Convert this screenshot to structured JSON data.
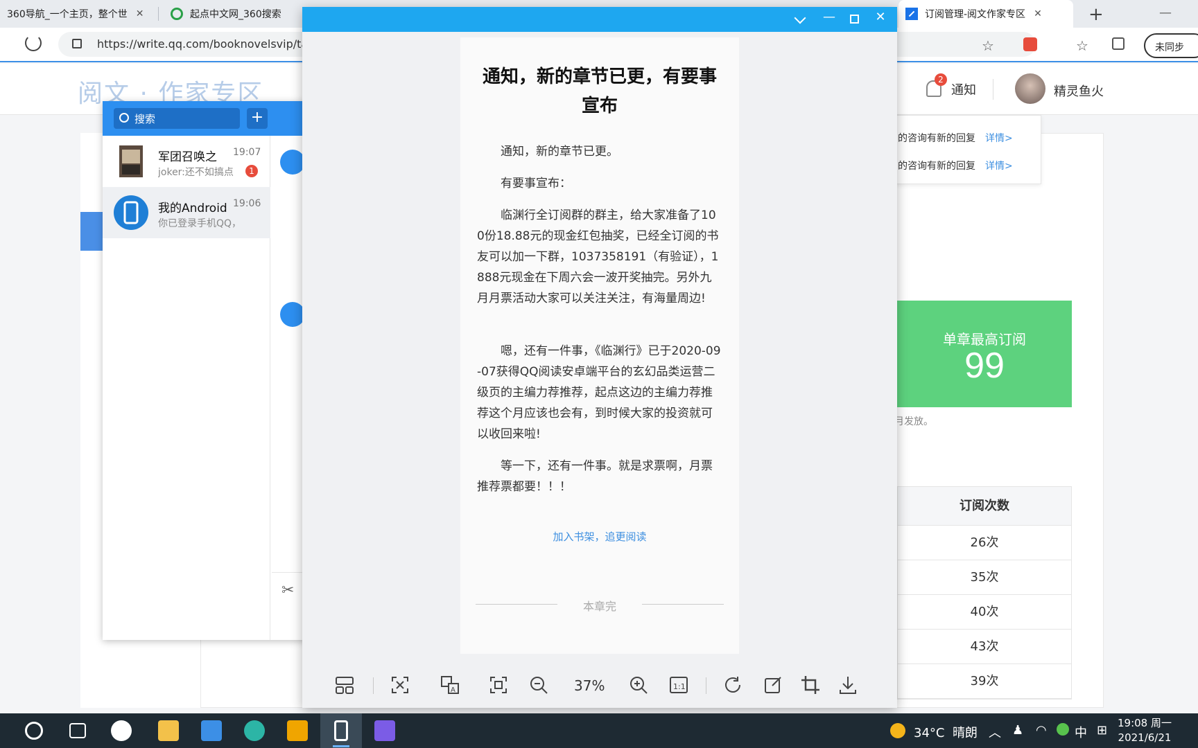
{
  "browser": {
    "tabs": [
      {
        "title": "360导航_一个主页，整个世"
      },
      {
        "title": "起点中文网_360搜索"
      },
      {
        "title": "订阅管理-阅文作家专区"
      }
    ],
    "url": "https://write.qq.com/booknovelsvip/ta",
    "sync_label": "未同步"
  },
  "site": {
    "logo": "阅文 · 作家专区",
    "notice_count": "2",
    "notice_label": "通知",
    "username": "精灵鱼火",
    "notifications": [
      {
        "text": "的咨询有新的回复",
        "link": "详情>"
      },
      {
        "text": "的咨询有新的回复",
        "link": "详情>"
      }
    ],
    "stat": {
      "label": "单章最高订阅",
      "value": "99"
    },
    "note": "月发放。",
    "table": {
      "header": "订阅次数",
      "rows": [
        "26次",
        "35次",
        "40次",
        "43次",
        "39次"
      ]
    }
  },
  "qq": {
    "search_placeholder": "搜索",
    "plus": "+",
    "chats": [
      {
        "name": "军团召唤之",
        "time": "19:07",
        "preview": "joker:还不如搞点",
        "unread": "1"
      },
      {
        "name": "我的Android",
        "time": "19:06",
        "preview": "你已登录手机QQ，可"
      }
    ]
  },
  "viewer": {
    "zoom": "37%",
    "article": {
      "title": "通知，新的章节已更，有要事宣布",
      "paragraphs": [
        "通知，新的章节已更。",
        "有要事宣布：",
        "临渊行全订阅群的群主，给大家准备了100份18.88元的现金红包抽奖，已经全订阅的书友可以加一下群，1037358191（有验证），1888元现金在下周六会一波开奖抽完。另外九月月票活动大家可以关注关注，有海量周边!",
        "嗯，还有一件事，《临渊行》已于2020-09-07获得QQ阅读安卓端平台的玄幻品类运营二级页的主编力荐推荐，起点这边的主编力荐推荐这个月应该也会有，到时候大家的投资就可以收回来啦!",
        "等一下，还有一件事。就是求票啊，月票推荐票都要！！！"
      ],
      "bookshelf_link": "加入书架，追更阅读",
      "end_label": "本章完"
    }
  },
  "taskbar": {
    "weather_temp": "34°C",
    "weather_desc": "晴朗",
    "ime": "中",
    "clock_time": "19:08 周一",
    "clock_date": "2021/6/21"
  }
}
